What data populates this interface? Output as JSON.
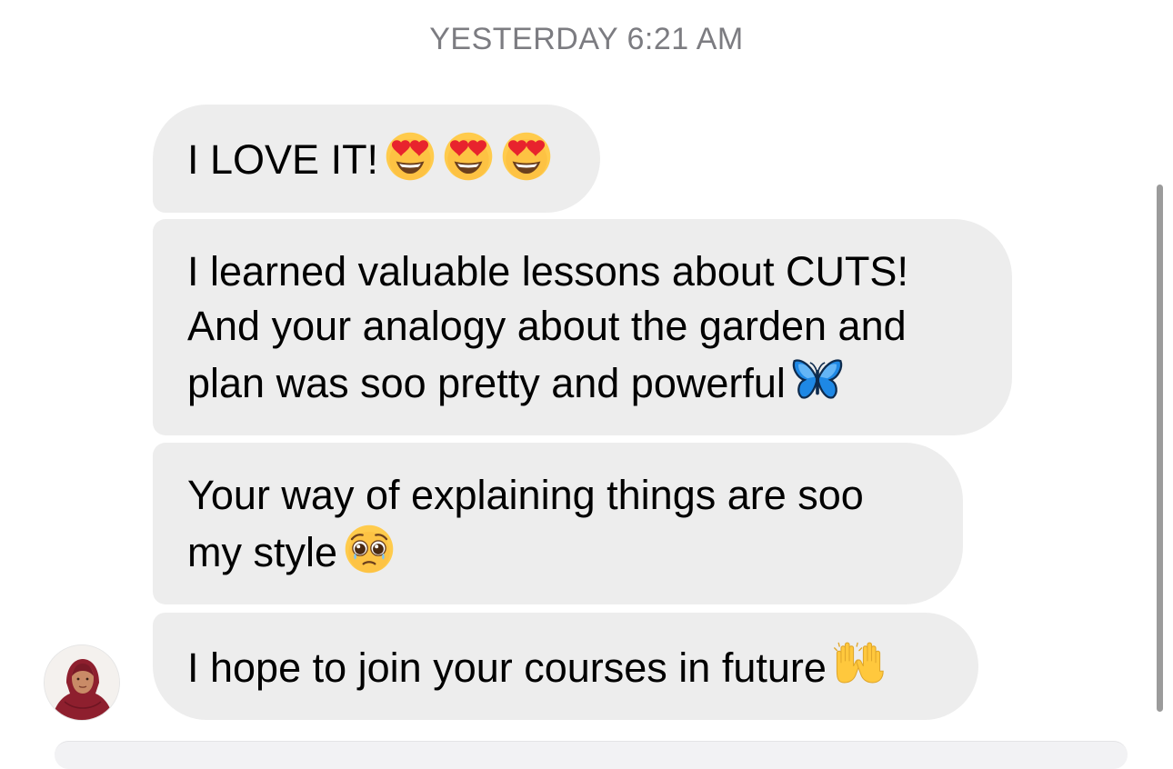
{
  "conversation": {
    "timestamp": "YESTERDAY 6:21 AM",
    "messages": [
      {
        "lines": [
          "I LOVE IT!"
        ],
        "emojis": [
          "heart-eyes-face",
          "heart-eyes-face",
          "heart-eyes-face"
        ]
      },
      {
        "lines": [
          "I learned valuable lessons about CUTS!",
          "And your analogy about the garden and",
          "plan was soo pretty and powerful"
        ],
        "emojis": [
          "butterfly"
        ]
      },
      {
        "lines": [
          "Your way of explaining things are soo",
          "my style"
        ],
        "emojis": [
          "pleading-face"
        ]
      },
      {
        "lines": [
          "I hope to join your courses in future"
        ],
        "emojis": [
          "raising-hands"
        ]
      }
    ]
  },
  "colors": {
    "bubble_background": "#ededed",
    "timestamp_text": "#7c7c81",
    "message_text": "#000000"
  }
}
